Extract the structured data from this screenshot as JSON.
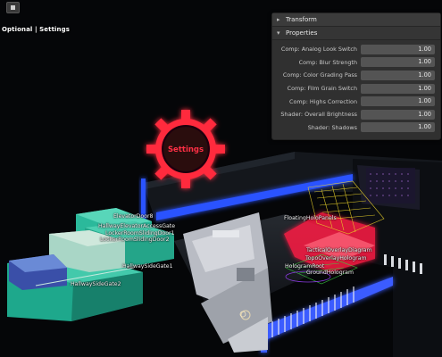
{
  "toolbar": {
    "header_text": "Optional | Settings"
  },
  "panel": {
    "transform_header": "Transform",
    "properties_header": "Properties",
    "properties": [
      {
        "label": "Comp: Analog Look Switch",
        "value": "1.00"
      },
      {
        "label": "Comp: Blur Strength",
        "value": "1.00"
      },
      {
        "label": "Comp: Color Grading Pass",
        "value": "1.00"
      },
      {
        "label": "Comp: Film Grain Switch",
        "value": "1.00"
      },
      {
        "label": "Comp: Highs Correction",
        "value": "1.00"
      },
      {
        "label": "Shader: Overall Brightness",
        "value": "1.00"
      },
      {
        "label": "Shader: Shadows",
        "value": "1.00"
      }
    ]
  },
  "scene": {
    "settings_gear_text": "Settings",
    "labels": {
      "elevator_door": "ElevatorDoor8",
      "hallway_elevator_gate": "HallwayElevatorAccessGate",
      "locker_room_door1": "LockerRoomSlidingDoor1",
      "locker_room_door2": "LockerRoomSlidingDoor2",
      "hallway_side_gate1": "HallwaySideGate1",
      "hallway_side_gate2": "HallwaySideGate2",
      "floating_holo_panels": "FloatingHoloPanels",
      "tactical_overlay": "TacticalOverlayDiagram",
      "topo_overlay": "TopoOverlayHologram",
      "hologram_root": "HologramRoot",
      "ground_hologram": "GroundHologram"
    }
  }
}
